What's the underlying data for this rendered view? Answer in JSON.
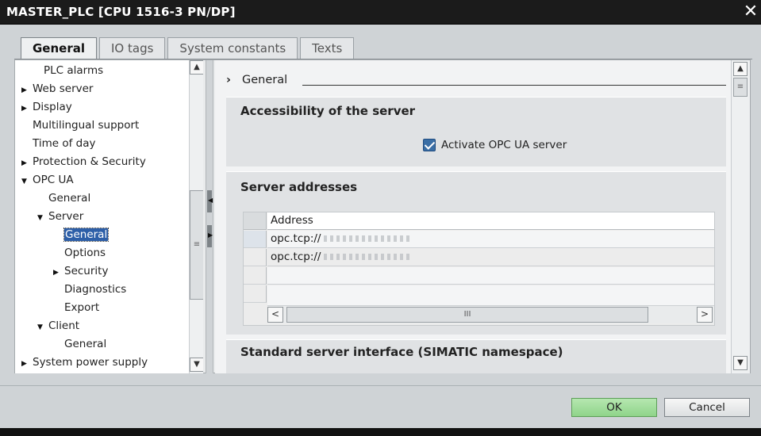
{
  "window": {
    "title": "MASTER_PLC [CPU 1516-3 PN/DP]",
    "close_glyph": "✕"
  },
  "tabs": [
    {
      "label": "General",
      "active": true
    },
    {
      "label": "IO tags"
    },
    {
      "label": "System constants"
    },
    {
      "label": "Texts"
    }
  ],
  "tree": {
    "items": [
      {
        "label": "PLC alarms",
        "arrow": ""
      },
      {
        "label": "Web server",
        "arrow": "▶"
      },
      {
        "label": "Display",
        "arrow": "▶"
      },
      {
        "label": "Multilingual support",
        "arrow": ""
      },
      {
        "label": "Time of day",
        "arrow": ""
      },
      {
        "label": "Protection & Security",
        "arrow": "▶"
      },
      {
        "label": "OPC UA",
        "arrow": "▼"
      },
      {
        "label": "General",
        "arrow": ""
      },
      {
        "label": "Server",
        "arrow": "▼"
      },
      {
        "label": "General",
        "arrow": "",
        "selected": true
      },
      {
        "label": "Options",
        "arrow": ""
      },
      {
        "label": "Security",
        "arrow": "▶"
      },
      {
        "label": "Diagnostics",
        "arrow": ""
      },
      {
        "label": "Export",
        "arrow": ""
      },
      {
        "label": "Client",
        "arrow": "▼"
      },
      {
        "label": "General",
        "arrow": ""
      },
      {
        "label": "System power supply",
        "arrow": "▶"
      }
    ]
  },
  "content": {
    "breadcrumb": "General",
    "breadcrumb_chevron": "›",
    "accessibility": {
      "title": "Accessibility of the server",
      "checkbox_label": "Activate OPC UA server",
      "checked": true
    },
    "server_addresses": {
      "title": "Server addresses",
      "column_header": "Address",
      "rows": [
        "opc.tcp://",
        "opc.tcp://"
      ],
      "scroll_left": "<",
      "scroll_right": ">",
      "scroll_grip": "III"
    },
    "standard_interface": {
      "title": "Standard server interface (SIMATIC namespace)"
    }
  },
  "scroll": {
    "up": "▲",
    "down": "▼",
    "grip": "≡"
  },
  "footer": {
    "ok_label": "OK",
    "cancel_label": "Cancel"
  }
}
